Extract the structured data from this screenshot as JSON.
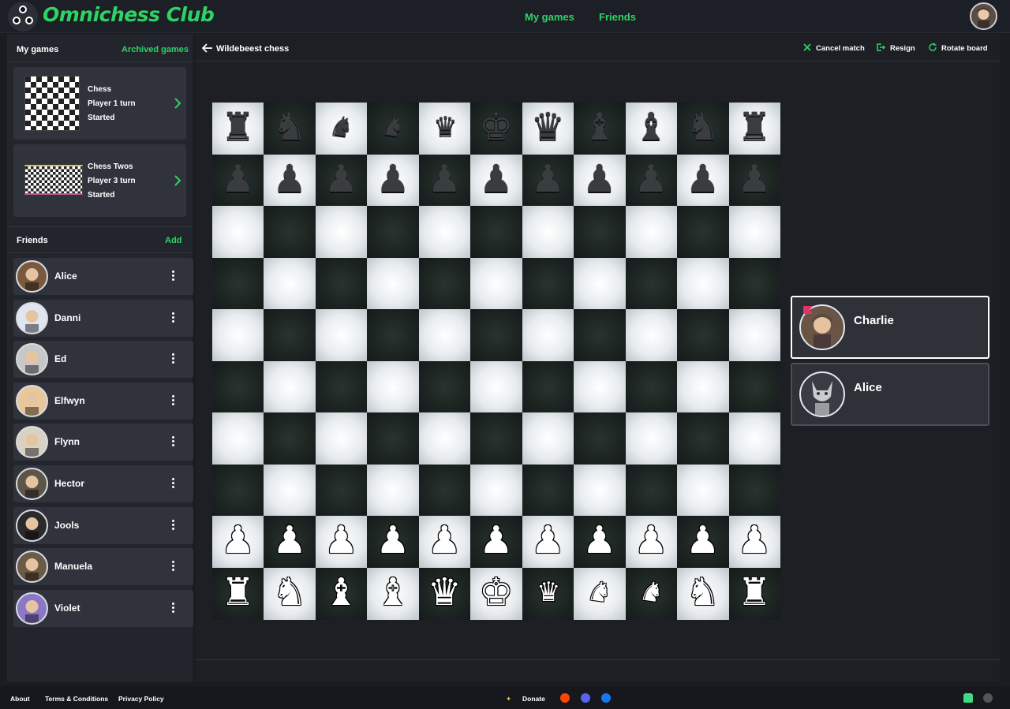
{
  "header": {
    "brand": "Omnichess Club",
    "nav": [
      {
        "label": "My games"
      },
      {
        "label": "Friends"
      }
    ]
  },
  "sidebar": {
    "games_title": "My games",
    "archived_link": "Archived games",
    "games": [
      {
        "name": "Chess",
        "turn": "Player 1 turn",
        "status": "Started"
      },
      {
        "name": "Chess Twos",
        "turn": "Player 3 turn",
        "status": "Started"
      }
    ],
    "friends_title": "Friends",
    "add_link": "Add",
    "friends": [
      {
        "name": "Alice",
        "avatar_color": "#7a5a3f"
      },
      {
        "name": "Danni",
        "avatar_color": "#dfe6f0"
      },
      {
        "name": "Ed",
        "avatar_color": "#c7c7c7"
      },
      {
        "name": "Elfwyn",
        "avatar_color": "#e8c79a"
      },
      {
        "name": "Flynn",
        "avatar_color": "#d9d2c2"
      },
      {
        "name": "Hector",
        "avatar_color": "#5d5548"
      },
      {
        "name": "Jools",
        "avatar_color": "#2a2a2a"
      },
      {
        "name": "Manuela",
        "avatar_color": "#6b5a45"
      },
      {
        "name": "Violet",
        "avatar_color": "#8a78c7"
      }
    ]
  },
  "main": {
    "game_title": "Wildebeest chess",
    "actions": [
      {
        "label": "Cancel match",
        "icon": "close-icon"
      },
      {
        "label": "Resign",
        "icon": "exit-icon"
      },
      {
        "label": "Rotate board",
        "icon": "rotate-icon"
      }
    ]
  },
  "board": {
    "files": 11,
    "ranks": 10,
    "rows": [
      [
        "bR",
        "bN",
        "bC",
        "bC",
        "bW",
        "bK",
        "bQ",
        "bB",
        "bB",
        "bN",
        "bR"
      ],
      [
        "bP",
        "bP",
        "bP",
        "bP",
        "bP",
        "bP",
        "bP",
        "bP",
        "bP",
        "bP",
        "bP"
      ],
      [
        "",
        "",
        "",
        "",
        "",
        "",
        "",
        "",
        "",
        "",
        ""
      ],
      [
        "",
        "",
        "",
        "",
        "",
        "",
        "",
        "",
        "",
        "",
        ""
      ],
      [
        "",
        "",
        "",
        "",
        "",
        "",
        "",
        "",
        "",
        "",
        ""
      ],
      [
        "",
        "",
        "",
        "",
        "",
        "",
        "",
        "",
        "",
        "",
        ""
      ],
      [
        "",
        "",
        "",
        "",
        "",
        "",
        "",
        "",
        "",
        "",
        ""
      ],
      [
        "",
        "",
        "",
        "",
        "",
        "",
        "",
        "",
        "",
        "",
        ""
      ],
      [
        "wP",
        "wP",
        "wP",
        "wP",
        "wP",
        "wP",
        "wP",
        "wP",
        "wP",
        "wP",
        "wP"
      ],
      [
        "wR",
        "wN",
        "wB",
        "wB",
        "wQ",
        "wK",
        "wW",
        "wC",
        "wC",
        "wN",
        "wR"
      ]
    ]
  },
  "players": [
    {
      "name": "Charlie",
      "active": true
    },
    {
      "name": "Alice",
      "active": false
    }
  ],
  "footer": {
    "links": [
      "About",
      "Terms & Conditions",
      "Privacy Policy"
    ],
    "donate": "Donate"
  },
  "colors": {
    "accent": "#2ed366",
    "background": "#1b1c22",
    "panel": "#31333c"
  }
}
